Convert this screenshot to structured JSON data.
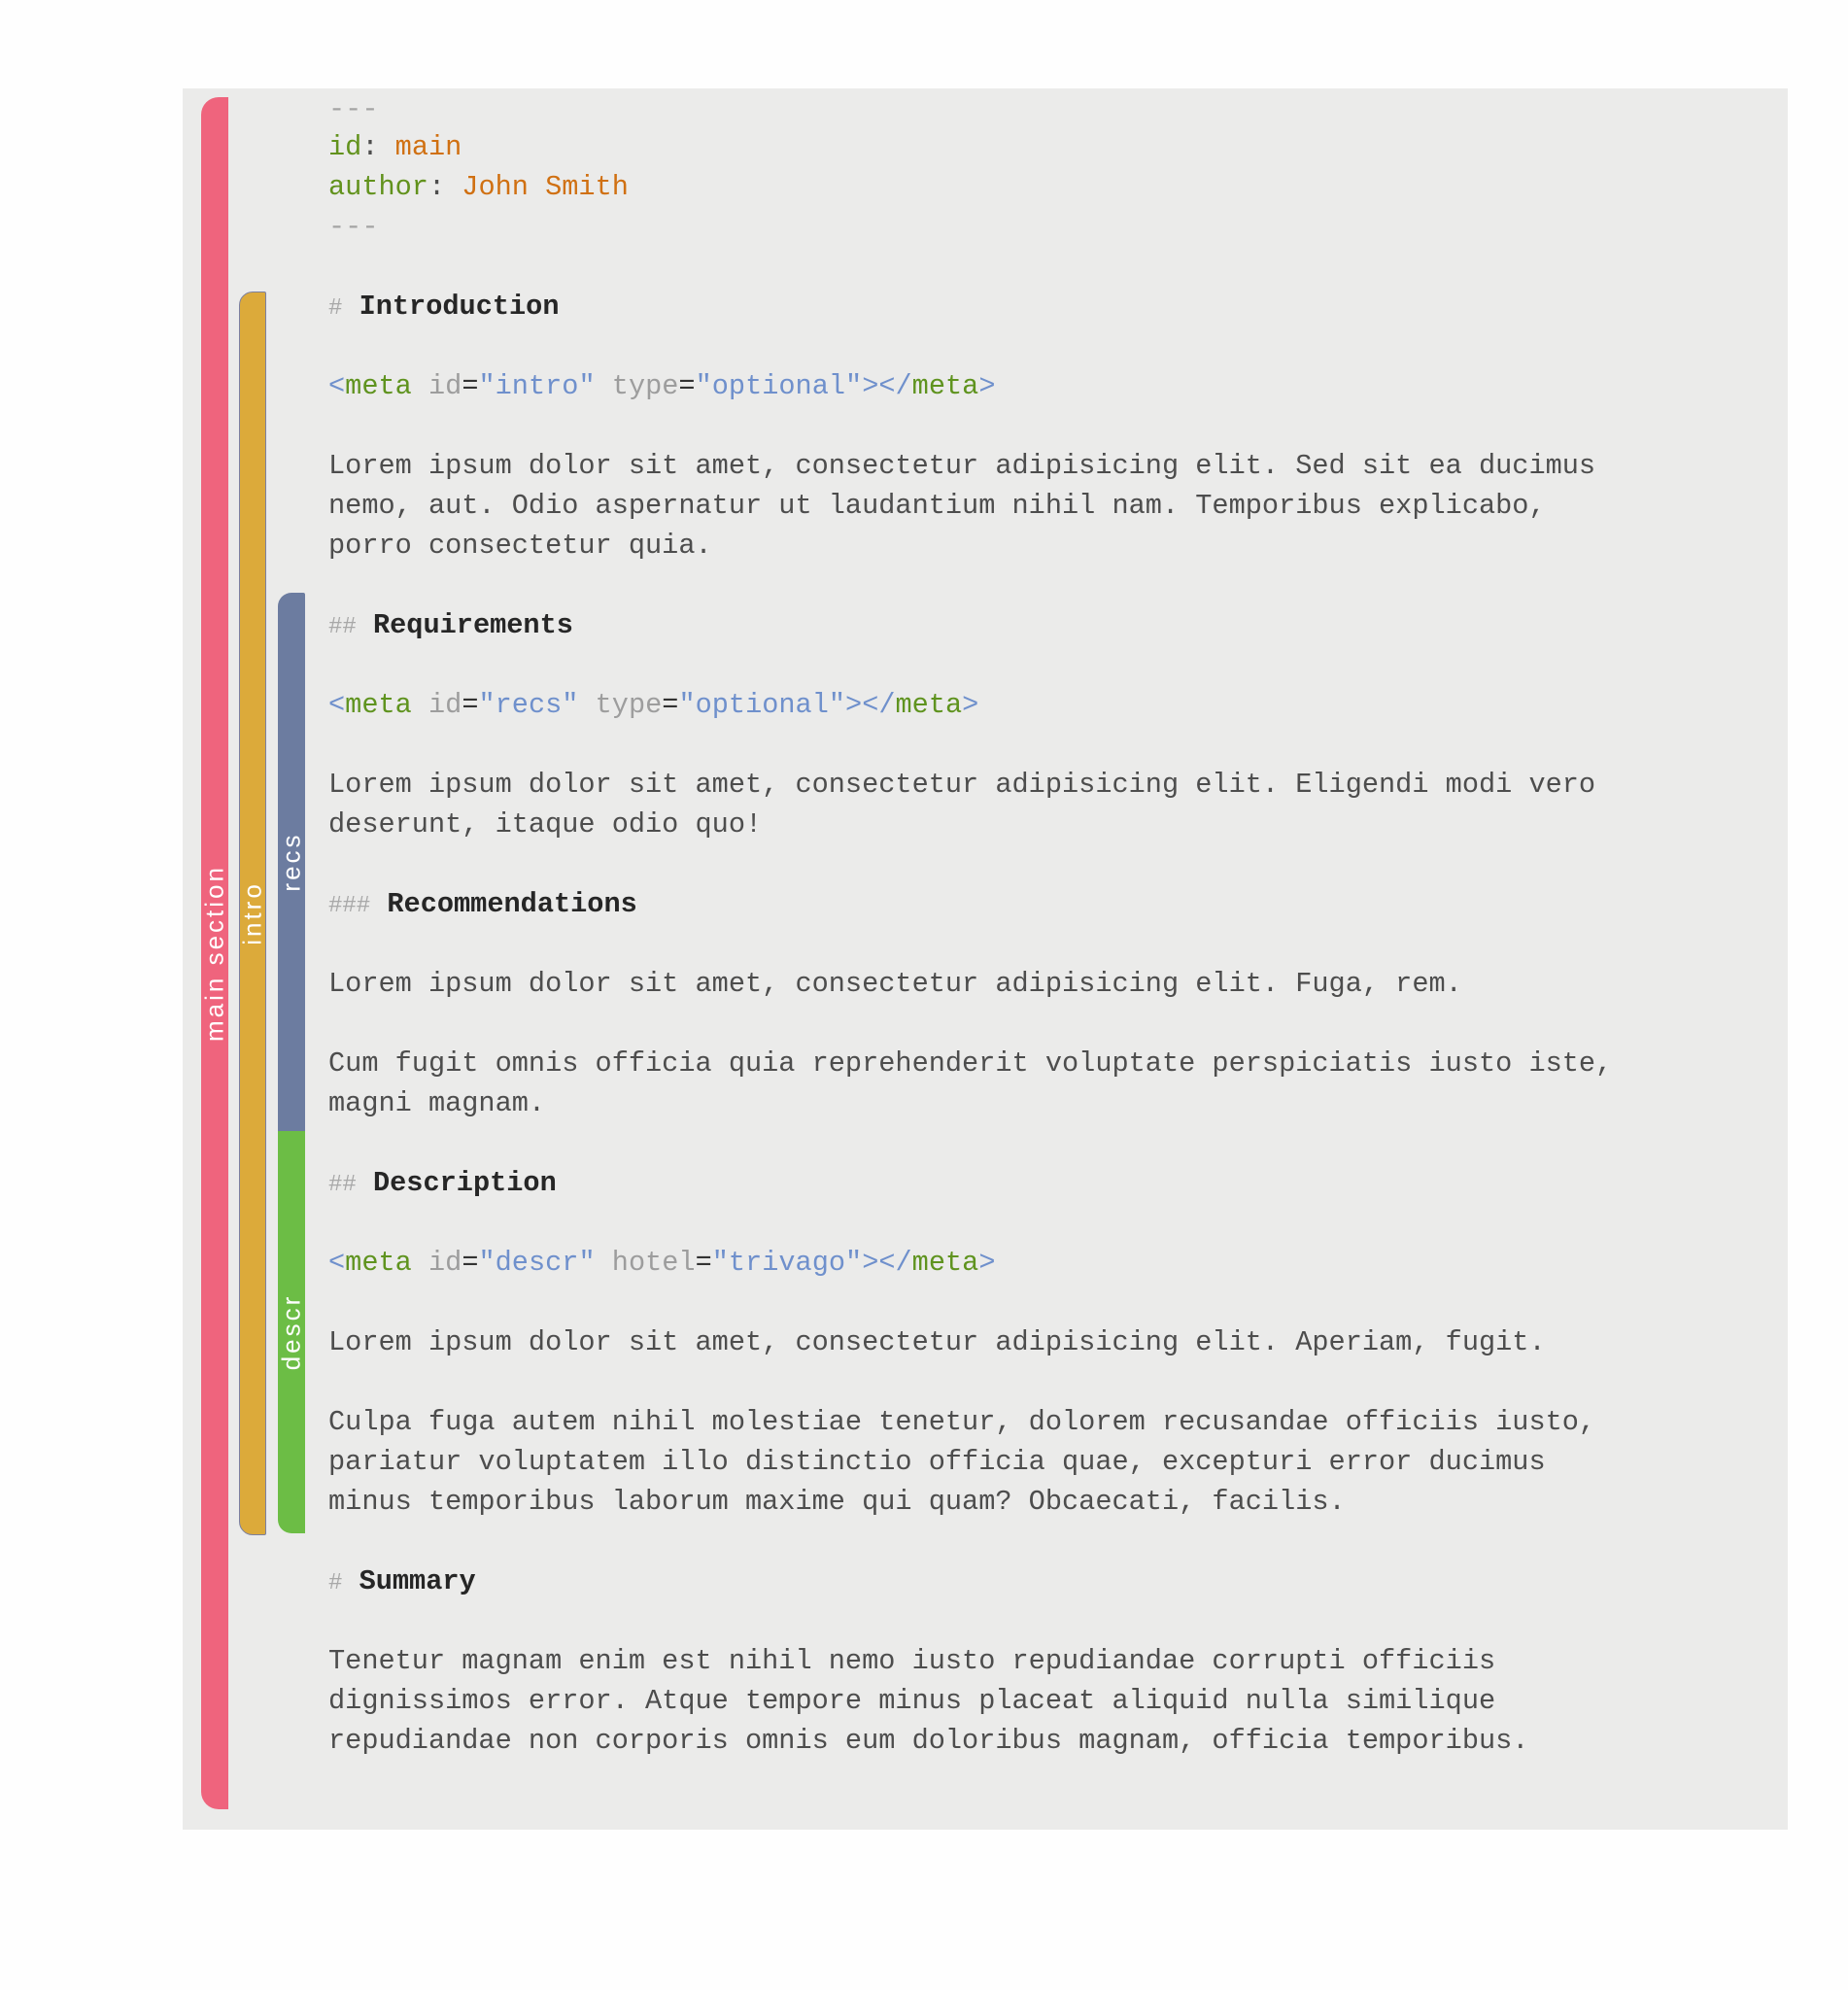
{
  "frontmatter": {
    "open": "---",
    "close": "---",
    "id_key": "id",
    "id_value": "main",
    "author_key": "author",
    "author_value": "John Smith"
  },
  "bands": {
    "main": "main section",
    "intro": "intro",
    "recs": "recs",
    "descr": "descr"
  },
  "meta_tags": [
    {
      "open": "<",
      "tag": "meta",
      "attr1": "id",
      "val1": "\"intro\"",
      "attr2": "type",
      "val2": "\"optional\"",
      "mid": "></",
      "close_tag": "meta",
      "end": ">"
    },
    {
      "open": "<",
      "tag": "meta",
      "attr1": "id",
      "val1": "\"recs\"",
      "attr2": "type",
      "val2": "\"optional\"",
      "mid": "></",
      "close_tag": "meta",
      "end": ">"
    },
    {
      "open": "<",
      "tag": "meta",
      "attr1": "id",
      "val1": "\"descr\"",
      "attr2": "hotel",
      "val2": "\"trivago\"",
      "mid": "></",
      "close_tag": "meta",
      "end": ">"
    }
  ],
  "headings": [
    {
      "hash": "#",
      "text": "Introduction"
    },
    {
      "hash": "##",
      "text": "Requirements"
    },
    {
      "hash": "###",
      "text": "Recommendations"
    },
    {
      "hash": "##",
      "text": "Description"
    },
    {
      "hash": "#",
      "text": "Summary"
    }
  ],
  "lines": [
    "Lorem ipsum dolor sit amet, consectetur adipisicing elit. Sed sit ea ducimus",
    "nemo, aut. Odio aspernatur ut laudantium nihil nam. Temporibus explicabo,",
    "porro consectetur quia.",
    "Lorem ipsum dolor sit amet, consectetur adipisicing elit. Eligendi modi vero",
    "deserunt, itaque odio quo!",
    "Lorem ipsum dolor sit amet, consectetur adipisicing elit. Fuga, rem.",
    "Cum fugit omnis officia quia reprehenderit voluptate perspiciatis iusto iste,",
    "magni magnam.",
    "Lorem ipsum dolor sit amet, consectetur adipisicing elit. Aperiam, fugit.",
    "Culpa fuga autem nihil molestiae tenetur, dolorem recusandae officiis iusto,",
    "pariatur voluptatem illo distinctio officia quae, excepturi error ducimus",
    "minus temporibus laborum maxime qui quam? Obcaecati, facilis.",
    "Tenetur magnam enim est nihil nemo iusto repudiandae corrupti officiis",
    "dignissimos error. Atque tempore minus placeat aliquid nulla similique",
    "repudiandae non corporis omnis eum doloribus magnam, officia temporibus."
  ]
}
